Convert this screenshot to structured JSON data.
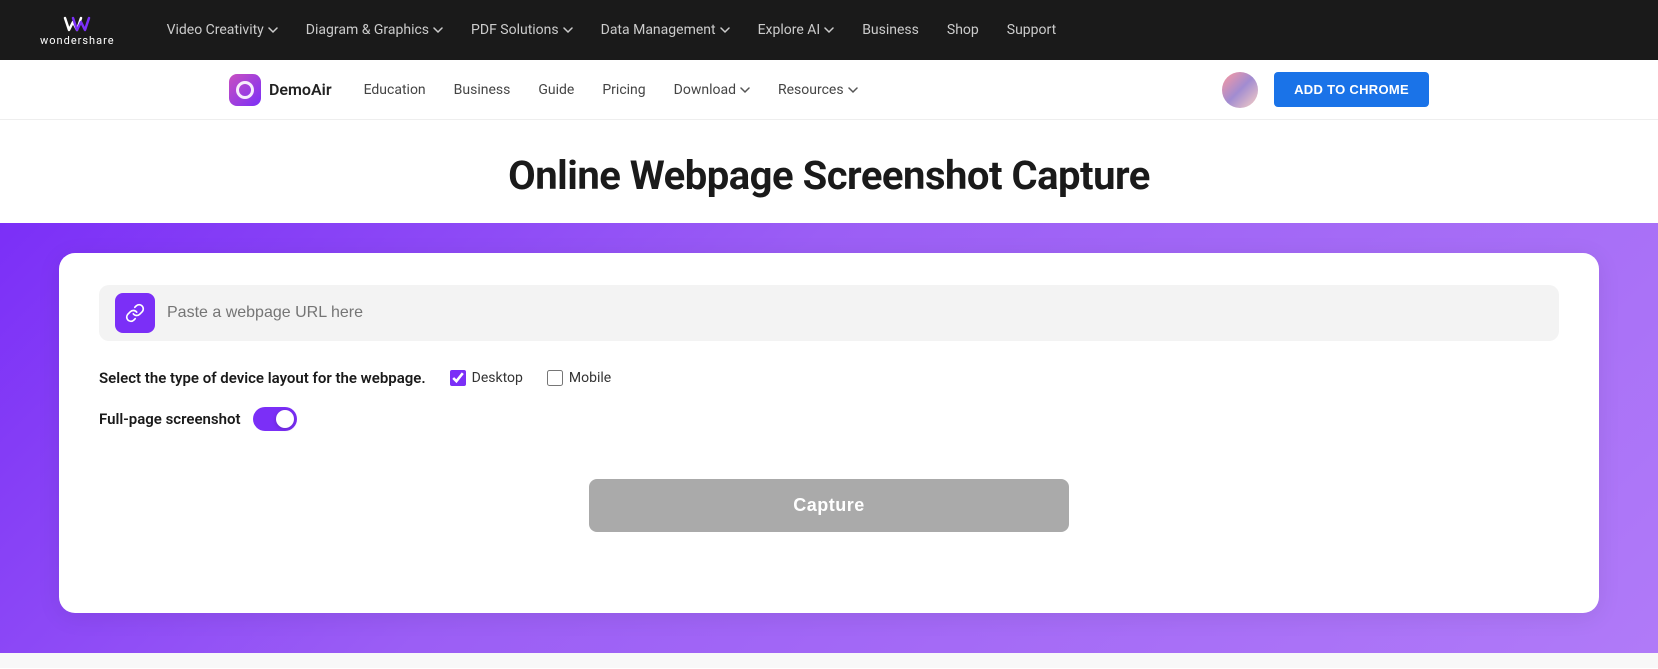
{
  "topNav": {
    "logoText": "wondershare",
    "items": [
      {
        "label": "Video Creativity",
        "hasDropdown": true
      },
      {
        "label": "Diagram & Graphics",
        "hasDropdown": true
      },
      {
        "label": "PDF Solutions",
        "hasDropdown": true
      },
      {
        "label": "Data Management",
        "hasDropdown": true
      },
      {
        "label": "Explore AI",
        "hasDropdown": true
      },
      {
        "label": "Business",
        "hasDropdown": false
      },
      {
        "label": "Shop",
        "hasDropdown": false
      },
      {
        "label": "Support",
        "hasDropdown": false
      }
    ]
  },
  "subNav": {
    "brandName": "DemoAir",
    "items": [
      {
        "label": "Education",
        "hasDropdown": false
      },
      {
        "label": "Business",
        "hasDropdown": false
      },
      {
        "label": "Guide",
        "hasDropdown": false
      },
      {
        "label": "Pricing",
        "hasDropdown": false
      },
      {
        "label": "Download",
        "hasDropdown": true
      },
      {
        "label": "Resources",
        "hasDropdown": true
      }
    ],
    "addToChromeLabel": "ADD TO CHROME"
  },
  "pageTitle": "Online Webpage Screenshot Capture",
  "captureCard": {
    "urlPlaceholder": "Paste a webpage URL here",
    "deviceLayoutLabel": "Select the type of device layout for the webpage.",
    "desktopLabel": "Desktop",
    "mobileLabel": "Mobile",
    "fullpageLabel": "Full-page screenshot",
    "captureButtonLabel": "Capture"
  }
}
